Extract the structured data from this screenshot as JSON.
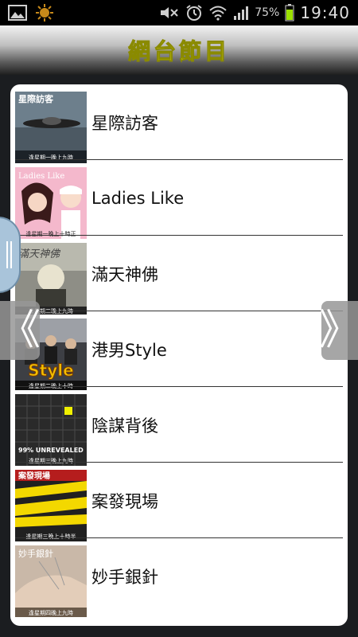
{
  "status_bar": {
    "battery_pct": "75%",
    "clock": "19:40"
  },
  "header": {
    "title": "網台節目"
  },
  "programs": [
    {
      "label": "星際訪客",
      "thumb_caption": "星際訪客",
      "thumb_sub": "逢星期一晚上九時"
    },
    {
      "label": "Ladies Like",
      "thumb_caption": "Ladies Like",
      "thumb_sub": "逢星期一晚上十時正"
    },
    {
      "label": "滿天神佛",
      "thumb_caption": "滿天神佛",
      "thumb_sub": "逢星期二晚上九時"
    },
    {
      "label": "港男Style",
      "thumb_caption": "Style",
      "thumb_sub": "逢星期二晚上十時"
    },
    {
      "label": "陰謀背後",
      "thumb_caption": "99% UNREVEALED",
      "thumb_sub": "逢星期三晚上九時"
    },
    {
      "label": "案發現場",
      "thumb_caption": "案發現場",
      "thumb_sub": "逢星期三晚上十時半"
    },
    {
      "label": "妙手銀針",
      "thumb_caption": "妙手銀針",
      "thumb_sub": "逢星期四晚上九時"
    }
  ],
  "nav": {
    "prev": "《",
    "next": "》"
  },
  "icons": {
    "gallery": "gallery-icon",
    "notification": "sun-notification-icon",
    "mute": "mute-icon",
    "alarm": "alarm-icon",
    "wifi": "wifi-icon",
    "signal": "signal-icon",
    "battery": "battery-icon"
  },
  "colors": {
    "title": "#f4f200",
    "battery": "#9be000",
    "panel": "#ffffff",
    "background": "#1b1d20"
  }
}
